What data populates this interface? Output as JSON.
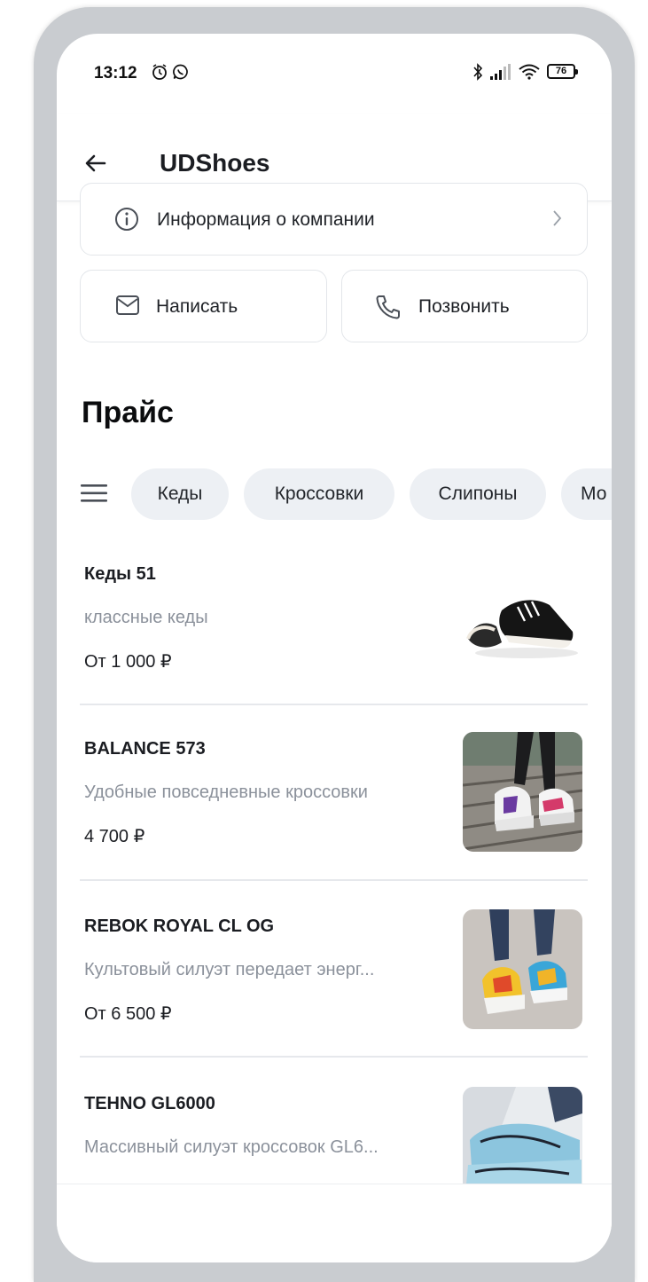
{
  "status_bar": {
    "time": "13:12",
    "battery": "76",
    "icons": [
      "alarm-icon",
      "whatsapp-icon",
      "bluetooth-icon",
      "signal-icon",
      "wifi-icon",
      "battery-icon"
    ]
  },
  "app_bar": {
    "title": "UDShoes",
    "back_icon": "back-arrow-icon"
  },
  "actions": {
    "info_label": "Информация о компании",
    "write_label": "Написать",
    "call_label": "Позвонить"
  },
  "price_section": {
    "title": "Прайс",
    "chips": [
      "Кеды",
      "Кроссовки",
      "Слипоны",
      "Мо"
    ]
  },
  "products": [
    {
      "name": "Кеды 51",
      "desc": "классные кеды",
      "price": "От 1 000 ₽"
    },
    {
      "name": "BALANCE 573",
      "desc": "Удобные повседневные кроссовки",
      "price": "4 700 ₽"
    },
    {
      "name": "REBOK ROYAL CL OG",
      "desc": "Культовый силуэт передает энерг...",
      "price": "От 6 500 ₽"
    },
    {
      "name": "TEHNO GL6000",
      "desc": "Массивный силуэт кроссовок GL6...",
      "price": ""
    }
  ],
  "colors": {
    "chip_bg": "#edf0f4",
    "muted_text": "#8b919b",
    "border": "#e3e6ea",
    "shell": "#c9ccd0"
  }
}
